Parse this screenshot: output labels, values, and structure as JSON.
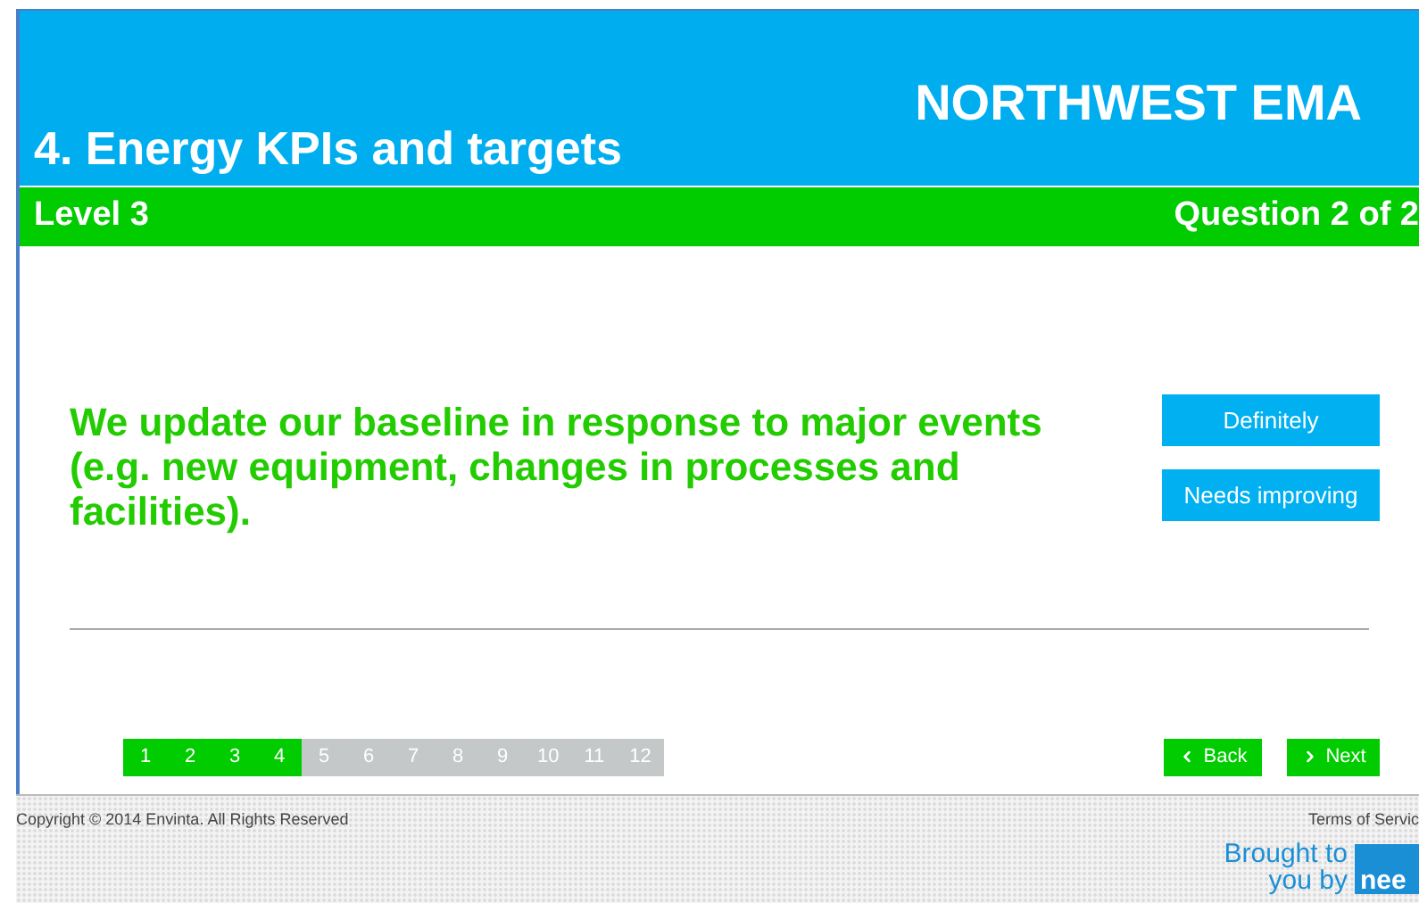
{
  "header": {
    "section_title": "4. Energy KPIs and targets",
    "brand": "NORTHWEST EMA"
  },
  "level_bar": {
    "level": "Level 3",
    "progress": "Question 2 of 2"
  },
  "question": "We update our baseline in response to major events (e.g. new equipment, changes in processes and facilities).",
  "answers": [
    "Definitely",
    "Needs improving"
  ],
  "pages": [
    {
      "label": "1",
      "completed": true
    },
    {
      "label": "2",
      "completed": true
    },
    {
      "label": "3",
      "completed": true
    },
    {
      "label": "4",
      "completed": true
    },
    {
      "label": "5",
      "completed": false
    },
    {
      "label": "6",
      "completed": false
    },
    {
      "label": "7",
      "completed": false
    },
    {
      "label": "8",
      "completed": false
    },
    {
      "label": "9",
      "completed": false
    },
    {
      "label": "10",
      "completed": false
    },
    {
      "label": "11",
      "completed": false
    },
    {
      "label": "12",
      "completed": false
    }
  ],
  "nav": {
    "back": "Back",
    "next": "Next"
  },
  "footer": {
    "copyright": "Copyright © 2014 Envinta. All Rights Reserved",
    "terms": "Terms of Servic",
    "brought_line1": "Brought to",
    "brought_line2": "you by",
    "logo": "nee"
  }
}
